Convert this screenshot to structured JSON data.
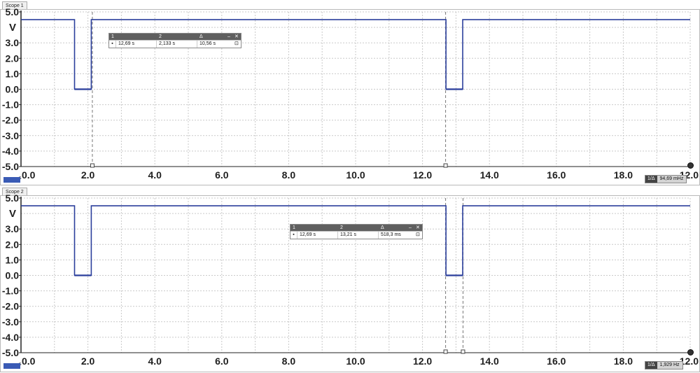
{
  "scopes": [
    {
      "title": "Scope 1",
      "unit": "V",
      "y_ticks": [
        "5.0",
        "3.0",
        "2.0",
        "1.0",
        "0.0",
        "-1.0",
        "-2.0",
        "-3.0",
        "-4.0",
        "-5.0"
      ],
      "x_ticks": [
        "0.0",
        "2.0",
        "4.0",
        "6.0",
        "8.0",
        "10.0",
        "12.0",
        "14.0",
        "16.0",
        "18.0",
        "12.0"
      ],
      "channel_badge": "",
      "x_unit_suffix": "s",
      "measurement": {
        "col1_header": "1",
        "col2_header": "2",
        "col3_header": "Δ",
        "minimize_label": "–",
        "close_label": "✕",
        "cursor1_value": "12,69 s",
        "cursor2_value": "2,133 s",
        "delta_value": "10,56 s"
      },
      "frequency": {
        "label": "1/Δ",
        "value": "94,69 mHz"
      }
    },
    {
      "title": "Scope 2",
      "unit": "V",
      "y_ticks": [
        "5.0",
        "3.0",
        "2.0",
        "1.0",
        "0.0",
        "-1.0",
        "-2.0",
        "-3.0",
        "-4.0",
        "-5.0"
      ],
      "x_ticks": [
        "0.0",
        "2.0",
        "4.0",
        "6.0",
        "8.0",
        "10.0",
        "12.0",
        "14.0",
        "16.0",
        "18.0",
        "12.0"
      ],
      "channel_badge": "",
      "x_unit_suffix": "s",
      "measurement": {
        "col1_header": "1",
        "col2_header": "2",
        "col3_header": "Δ",
        "minimize_label": "–",
        "close_label": "✕",
        "cursor1_value": "12,69 s",
        "cursor2_value": "13,21 s",
        "delta_value": "518,3 ms"
      },
      "frequency": {
        "label": "1/Δ",
        "value": "1,929 Hz"
      }
    }
  ],
  "chart_data": [
    {
      "type": "line",
      "title": "Scope 1",
      "xlabel": "",
      "ylabel": "V",
      "xlim": [
        0,
        20
      ],
      "ylim": [
        -5,
        5
      ],
      "grid": true,
      "series": [
        {
          "points": [
            [
              0,
              4.5
            ],
            [
              1.6,
              4.5
            ],
            [
              1.6,
              0
            ],
            [
              2.1,
              0
            ],
            [
              2.1,
              4.5
            ],
            [
              12.7,
              4.5
            ],
            [
              12.7,
              0
            ],
            [
              13.2,
              0
            ],
            [
              13.2,
              4.5
            ],
            [
              20,
              4.5
            ]
          ]
        }
      ],
      "cursors": [
        12.69,
        2.133
      ]
    },
    {
      "type": "line",
      "title": "Scope 2",
      "xlabel": "",
      "ylabel": "V",
      "xlim": [
        0,
        20
      ],
      "ylim": [
        -5,
        5
      ],
      "grid": true,
      "series": [
        {
          "points": [
            [
              0,
              4.5
            ],
            [
              1.6,
              4.5
            ],
            [
              1.6,
              0
            ],
            [
              2.1,
              0
            ],
            [
              2.1,
              4.5
            ],
            [
              12.7,
              4.5
            ],
            [
              12.7,
              0
            ],
            [
              13.2,
              0
            ],
            [
              13.2,
              4.5
            ],
            [
              20,
              4.5
            ]
          ]
        }
      ],
      "cursors": [
        12.69,
        13.21
      ]
    }
  ]
}
